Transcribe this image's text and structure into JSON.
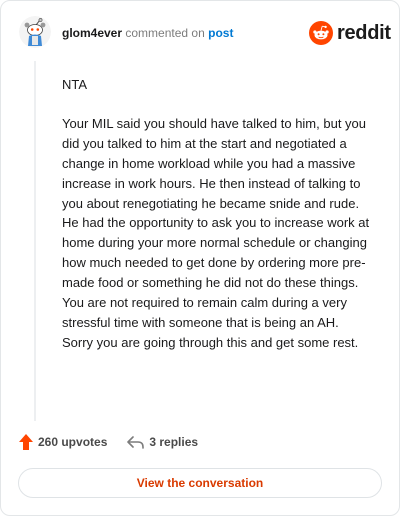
{
  "header": {
    "username": "glom4ever",
    "commented_on": "commented on",
    "post_link": "post",
    "brand_name": "reddit",
    "avatar_icon": "snoo-avatar-icon",
    "brand_icon": "reddit-alien-icon",
    "brand_color": "#ff4500"
  },
  "comment": {
    "verdict": "NTA",
    "text": "Your MIL said you should have talked to him, but you did you talked to him at the start and negotiated a change in home workload while you had a massive increase in work hours. He then instead of talking to you about renegotiating he became snide and rude. He had the opportunity to ask you to increase work at home during your more normal schedule or changing how much needed to get done by ordering more pre-made food or something he did not do these things. You are not required to remain calm during a very stressful time with someone that is being an AH. Sorry you are going through this and get some rest."
  },
  "actions": {
    "upvotes": "260 upvotes",
    "replies": "3 replies",
    "upvote_icon": "upvote-arrow-icon",
    "reply_icon": "reply-arrow-icon",
    "upvote_color": "#ff4500"
  },
  "footer": {
    "view_conversation": "View the conversation"
  }
}
